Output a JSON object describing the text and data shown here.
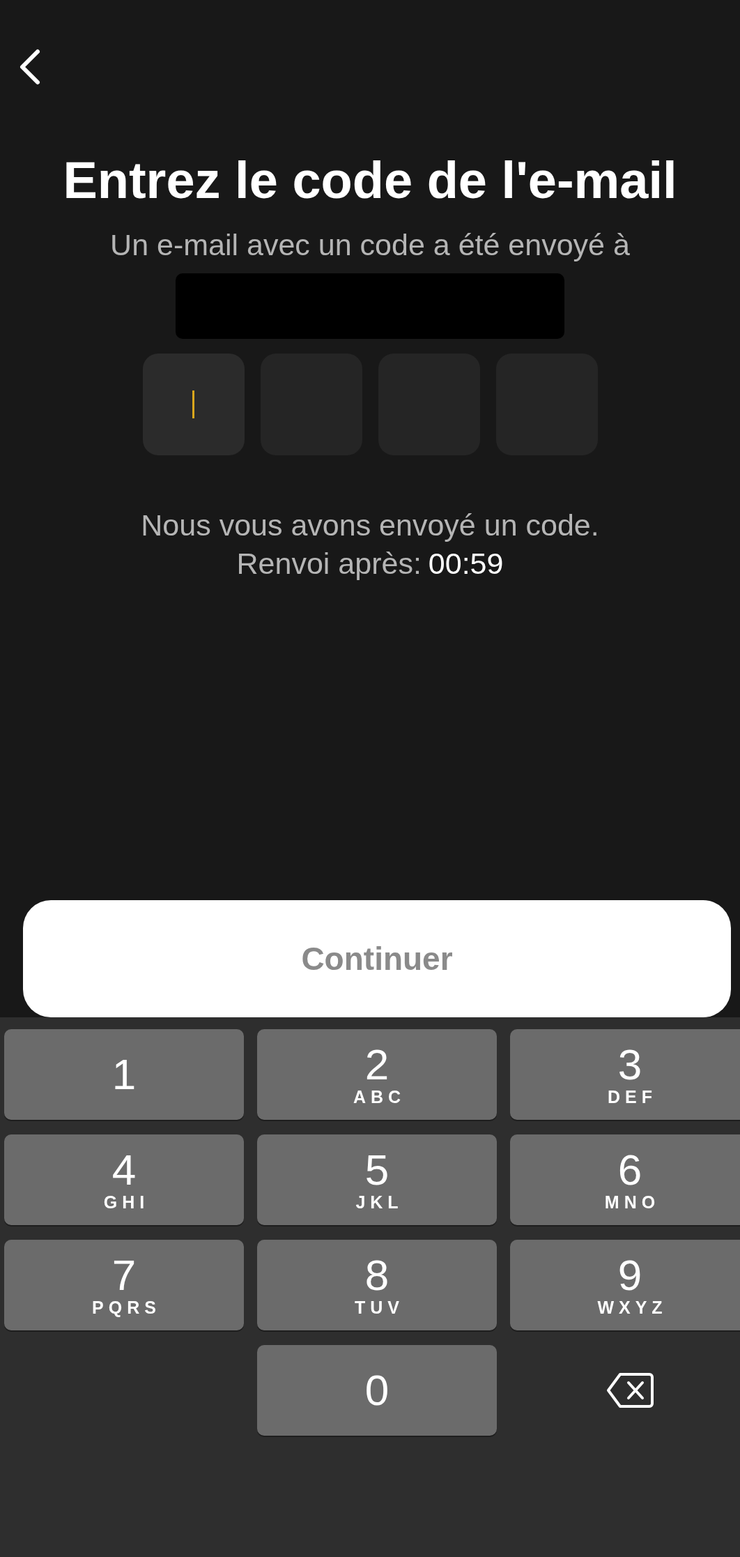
{
  "title": "Entrez le code de l'e-mail",
  "subtitle": "Un e-mail avec un code a été envoyé à",
  "recipient": {
    "kind": "redacted"
  },
  "code_boxes": [
    {
      "selected": true
    },
    {
      "selected": false
    },
    {
      "selected": false
    },
    {
      "selected": false
    }
  ],
  "message": "Nous vous avons envoyé un code.",
  "resend": {
    "label": "Renvoi après:",
    "countdown": "00:59"
  },
  "continue_button": {
    "label": "Continuer",
    "disabled": true
  },
  "keypad": [
    {
      "kind": "digit",
      "digit": "1"
    },
    {
      "kind": "digit",
      "digit": "2",
      "letters": "ABC"
    },
    {
      "kind": "digit",
      "digit": "3",
      "letters": "DEF"
    },
    {
      "kind": "digit",
      "digit": "4",
      "letters": "GHI"
    },
    {
      "kind": "digit",
      "digit": "5",
      "letters": "JKL"
    },
    {
      "kind": "digit",
      "digit": "6",
      "letters": "MNO"
    },
    {
      "kind": "digit",
      "digit": "7",
      "letters": "PQRS"
    },
    {
      "kind": "digit",
      "digit": "8",
      "letters": "TUV"
    },
    {
      "kind": "digit",
      "digit": "9",
      "letters": "WXYZ"
    },
    {
      "kind": "blank"
    },
    {
      "kind": "digit",
      "digit": "0"
    },
    {
      "kind": "delete"
    }
  ]
}
